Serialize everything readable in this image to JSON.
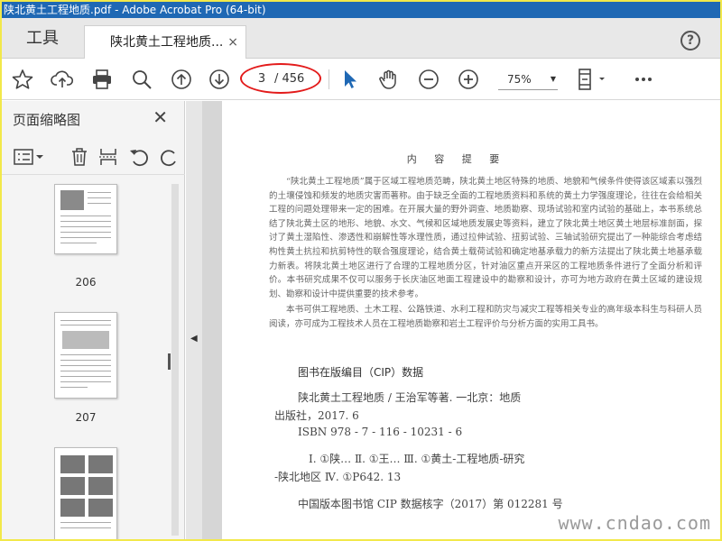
{
  "window": {
    "title": "陕北黄土工程地质.pdf - Adobe Acrobat Pro (64-bit)"
  },
  "tabs": {
    "tools_label": "工具",
    "doc_label": "陕北黄土工程地质...",
    "close_glyph": "×",
    "help_glyph": "?"
  },
  "toolbar": {
    "current_page": "3",
    "total_pages": "/ 456",
    "zoom": "75%",
    "zoom_arrow": "▼"
  },
  "sidebar": {
    "title": "页面缩略图",
    "close_glyph": "✕",
    "thumbnails": [
      {
        "page": "206"
      },
      {
        "page": "207"
      }
    ]
  },
  "document": {
    "heading": "内 容 提 要",
    "paragraph1": "“陕北黄土工程地质”属于区域工程地质范畴，陕北黄土地区特殊的地质、地貌和气候条件使得该区域素以强烈的土壤侵蚀和频发的地质灾害而著称。由于缺乏全面的工程地质资料和系统的黄土力学强度理论，往往在会给相关工程的问题处理带来一定的困难。在开展大量的野外调查、地质勘察、现场试验和室内试验的基础上，本书系统总结了陕北黄土区的地形、地貌、水文、气候和区域地质发展史等资料，建立了陕北黄土地区黄土地层标准剖面，探讨了黄土湿陷性、渗透性和崩解性等水理性质，通过拉伸试验、扭剪试验、三轴试验研究提出了一种能综合考虑结构性黄土抗拉和抗剪特性的联合强度理论，结合黄土载荷试验和确定地基承载力的新方法提出了陕北黄土地基承载力新表。将陕北黄土地区进行了合理的工程地质分区，针对油区重点开采区的工程地质条件进行了全面分析和评价。本书研究成果不仅可以服务于长庆油区地面工程建设中的勘察和设计，亦可为地方政府在黄土区域的建设规划、勘察和设计中提供重要的技术参考。",
    "paragraph2": "本书可供工程地质、土木工程、公路铁道、水利工程和防灾与减灾工程等相关专业的高年级本科生与科研人员阅读，亦可成为工程技术人员在工程地质勘察和岩土工程评价与分析方面的实用工具书。",
    "cip_title": "图书在版编目（CIP）数据",
    "cip_line1": "陕北黄土工程地质 / 王治军等著. 一北京：地质",
    "cip_line2": "出版社，2017. 6",
    "cip_line3": "ISBN 978 - 7 - 116 - 10231 - 6",
    "cip_line4": "Ⅰ. ①陕…   Ⅱ. ①王…   Ⅲ. ①黄土-工程地质-研究",
    "cip_line5": "-陕北地区   Ⅳ. ①P642. 13",
    "cip_line6": "中国版本图书馆 CIP 数据核字（2017）第 012281 号",
    "watermark": "www.cndao.com"
  },
  "colors": {
    "titlebar": "#1f68b4",
    "highlight_oval": "#e31b1b",
    "frame": "#f2e84a"
  }
}
